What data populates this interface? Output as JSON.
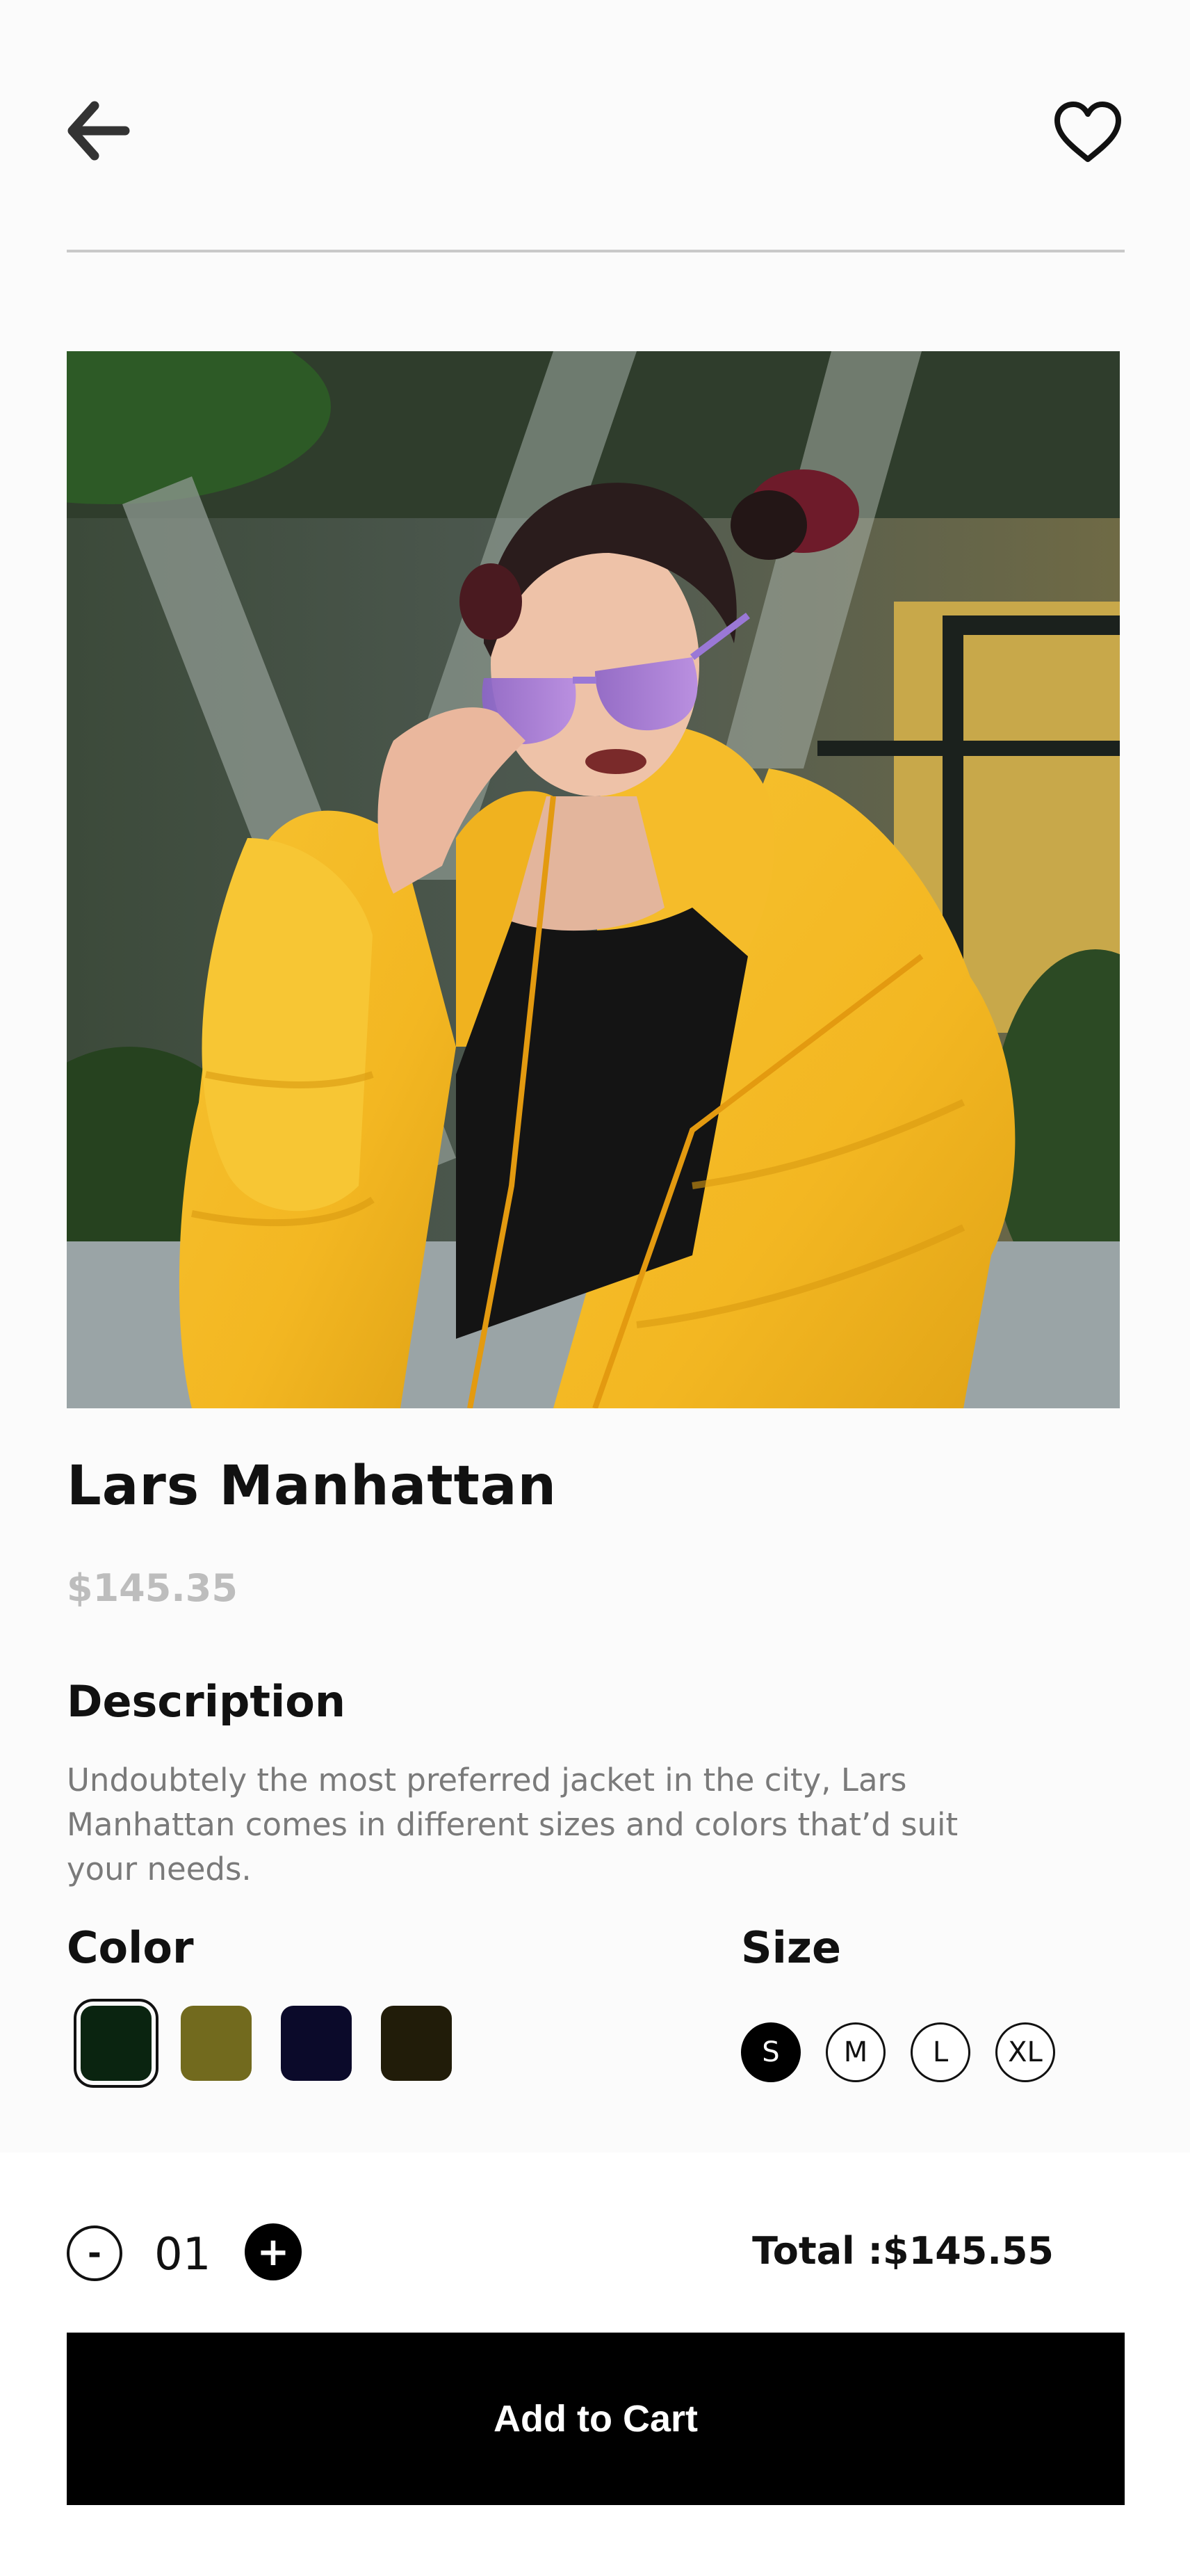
{
  "header": {
    "back_icon": "arrow-left-icon",
    "favorite_icon": "heart-outline-icon"
  },
  "product": {
    "name": "Lars Manhattan",
    "price": "$145.35",
    "image": "woman-in-yellow-puffer-jacket-photo"
  },
  "description": {
    "heading": "Description",
    "text": "Undoubtely the most preferred jacket in the city, Lars Manhattan comes in different sizes and colors that’d suit your needs."
  },
  "color": {
    "heading": "Color",
    "options": [
      "#0a2410",
      "#726a1e",
      "#0b0a2a",
      "#211c09"
    ],
    "selected_index": 0
  },
  "size": {
    "heading": "Size",
    "options": [
      "S",
      "M",
      "L",
      "XL"
    ],
    "selected": "S"
  },
  "quantity": {
    "minus_label": "-",
    "value": "01",
    "plus_label": "+"
  },
  "total": {
    "label": "Total :$145.55"
  },
  "cart": {
    "button_label": "Add to Cart"
  }
}
